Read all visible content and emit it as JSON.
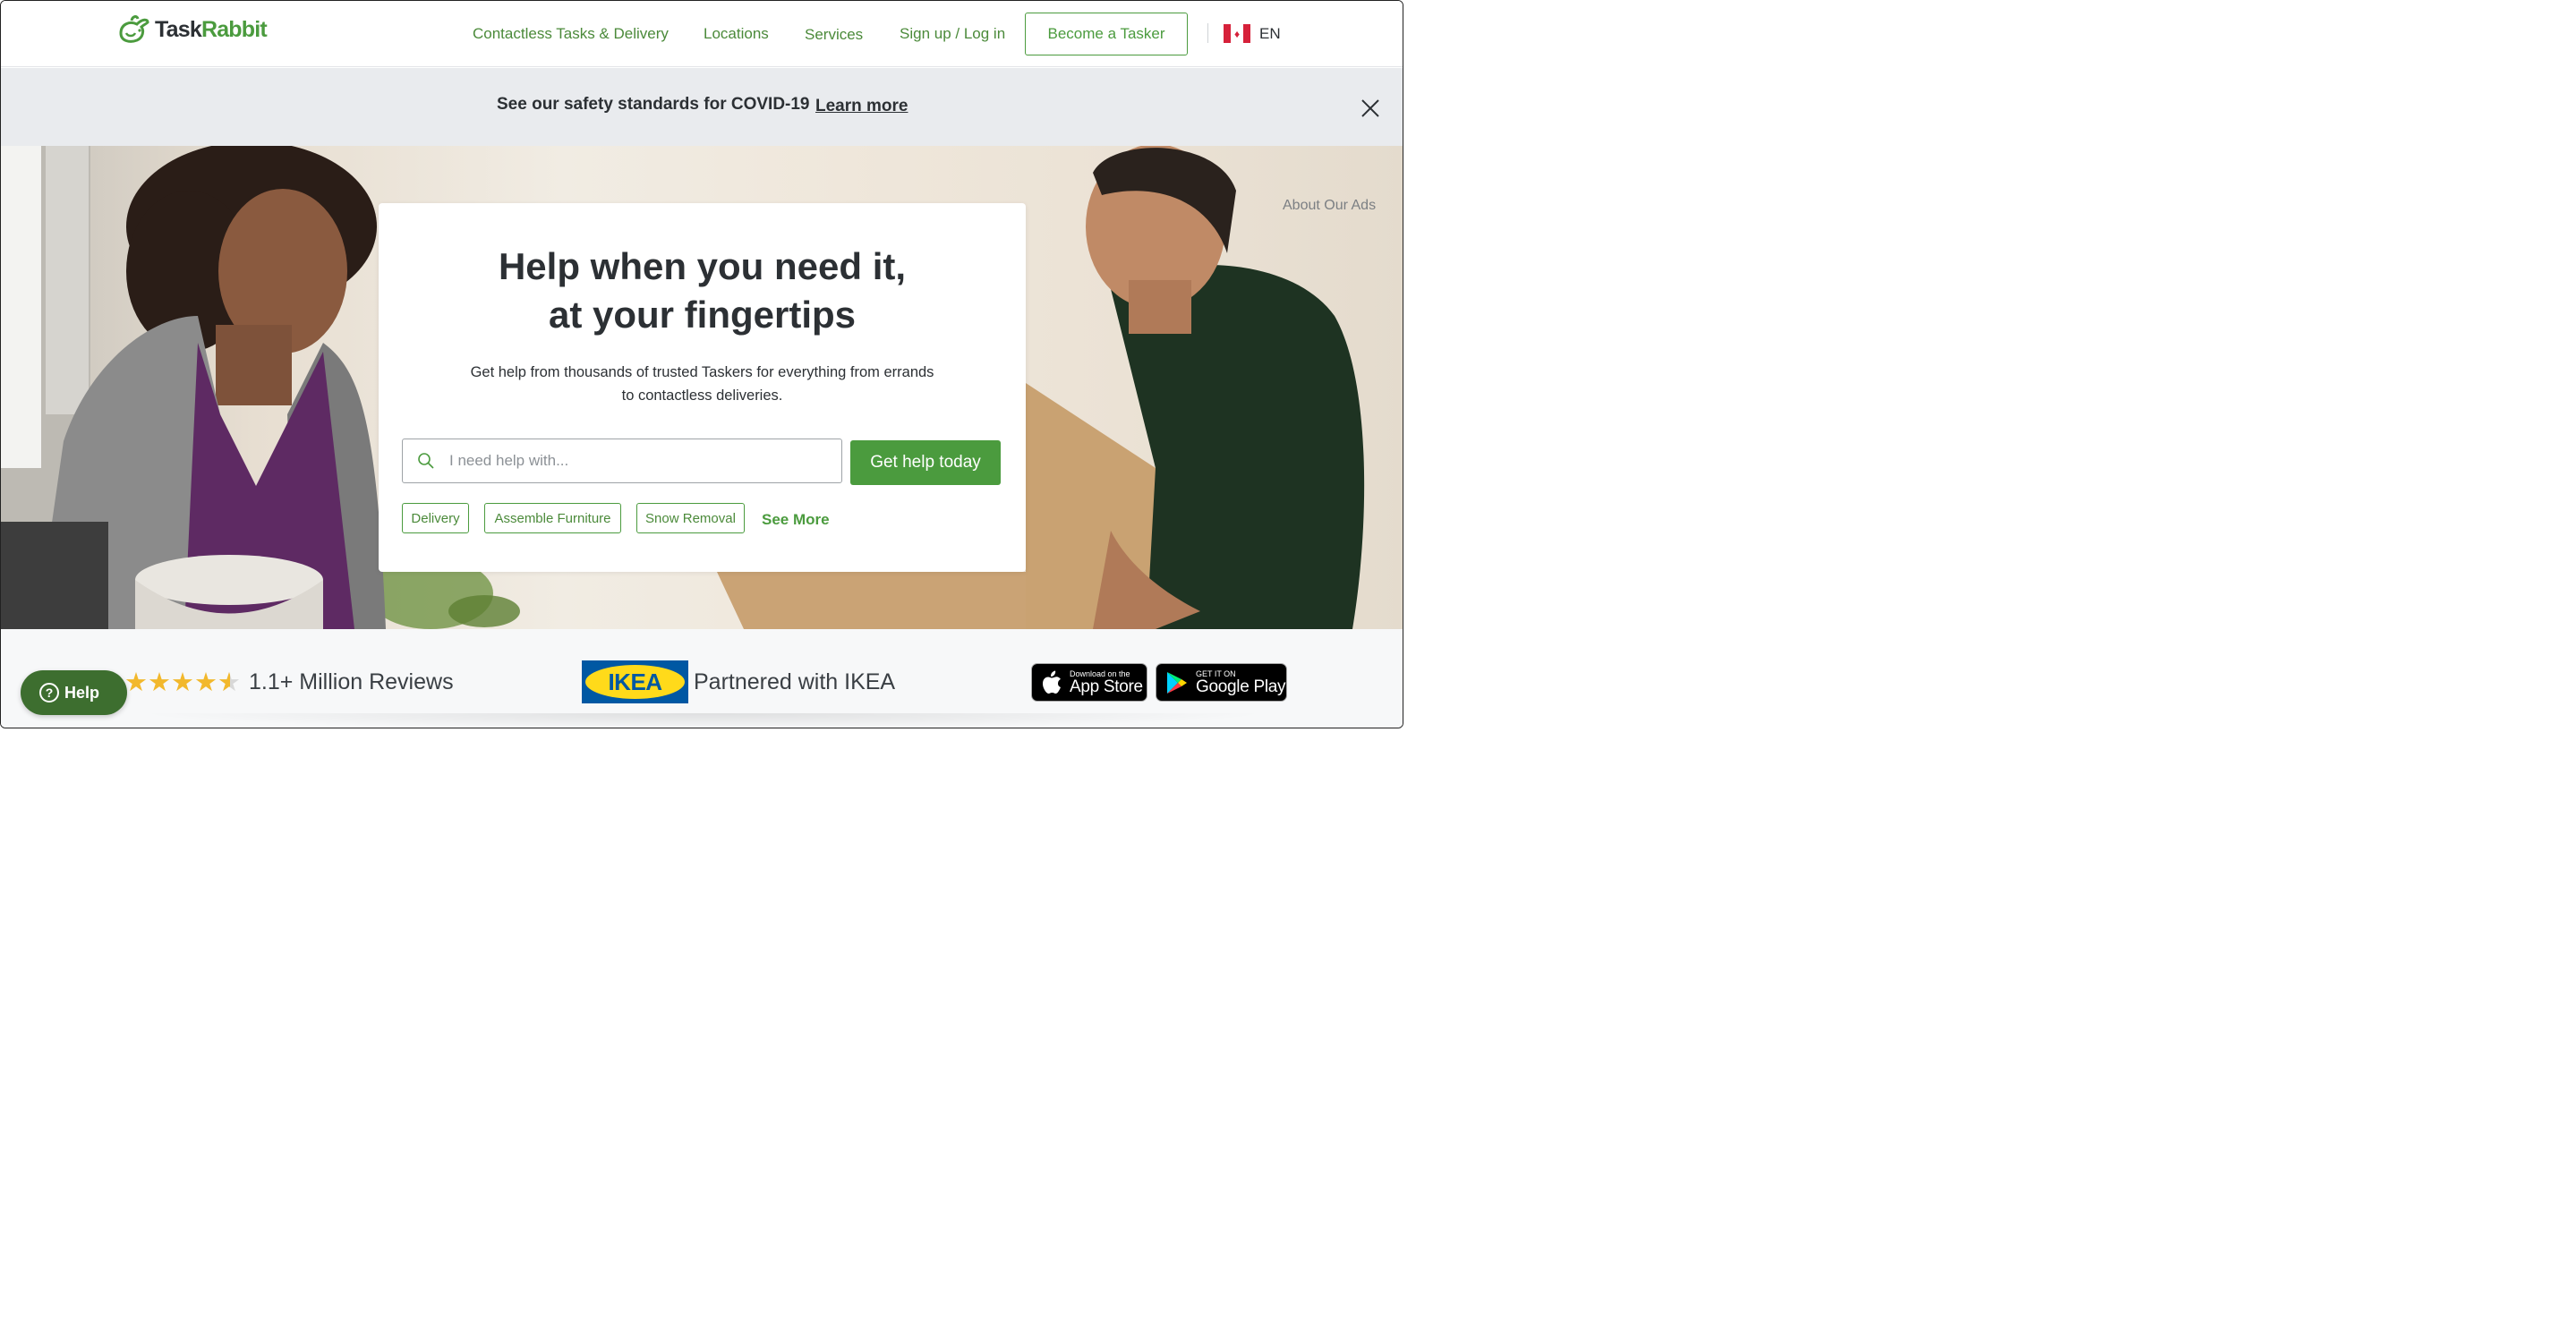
{
  "brand": {
    "name_part1": "Task",
    "name_part2": "Rabbit",
    "green": "#4b9b3e",
    "dark_green": "#3d6e2f"
  },
  "nav": {
    "items": [
      {
        "label": "Contactless Tasks & Delivery"
      },
      {
        "label": "Locations"
      },
      {
        "label": "Services"
      },
      {
        "label": "Sign up / Log in"
      }
    ],
    "become_tasker": "Become a Tasker",
    "language": "EN",
    "flag_icon": "canada-flag-icon"
  },
  "banner": {
    "text": "See our safety standards for COVID-19",
    "link": "Learn more",
    "close_icon": "close-icon"
  },
  "hero": {
    "about_ads": "About Our Ads",
    "title_line1": "Help when you need it,",
    "title_line2": "at your fingertips",
    "subtitle": "Get help from thousands of trusted Taskers for everything from errands to contactless deliveries.",
    "search": {
      "placeholder": "I need help with...",
      "value": "",
      "icon": "search-icon"
    },
    "cta": "Get help today",
    "chips": [
      {
        "label": "Delivery"
      },
      {
        "label": "Assemble Furniture"
      },
      {
        "label": "Snow Removal"
      }
    ],
    "see_more": "See More"
  },
  "footer_strip": {
    "rating_stars": 4.5,
    "reviews": "1.1+ Million Reviews",
    "ikea_logo": "IKEA",
    "ikea_text": "Partnered with IKEA",
    "app_store": {
      "small": "Download on the",
      "big": "App Store",
      "icon": "apple-icon"
    },
    "google_play": {
      "small": "GET IT ON",
      "big": "Google Play",
      "icon": "google-play-icon"
    }
  },
  "help_button": {
    "label": "Help",
    "icon": "question-icon"
  }
}
